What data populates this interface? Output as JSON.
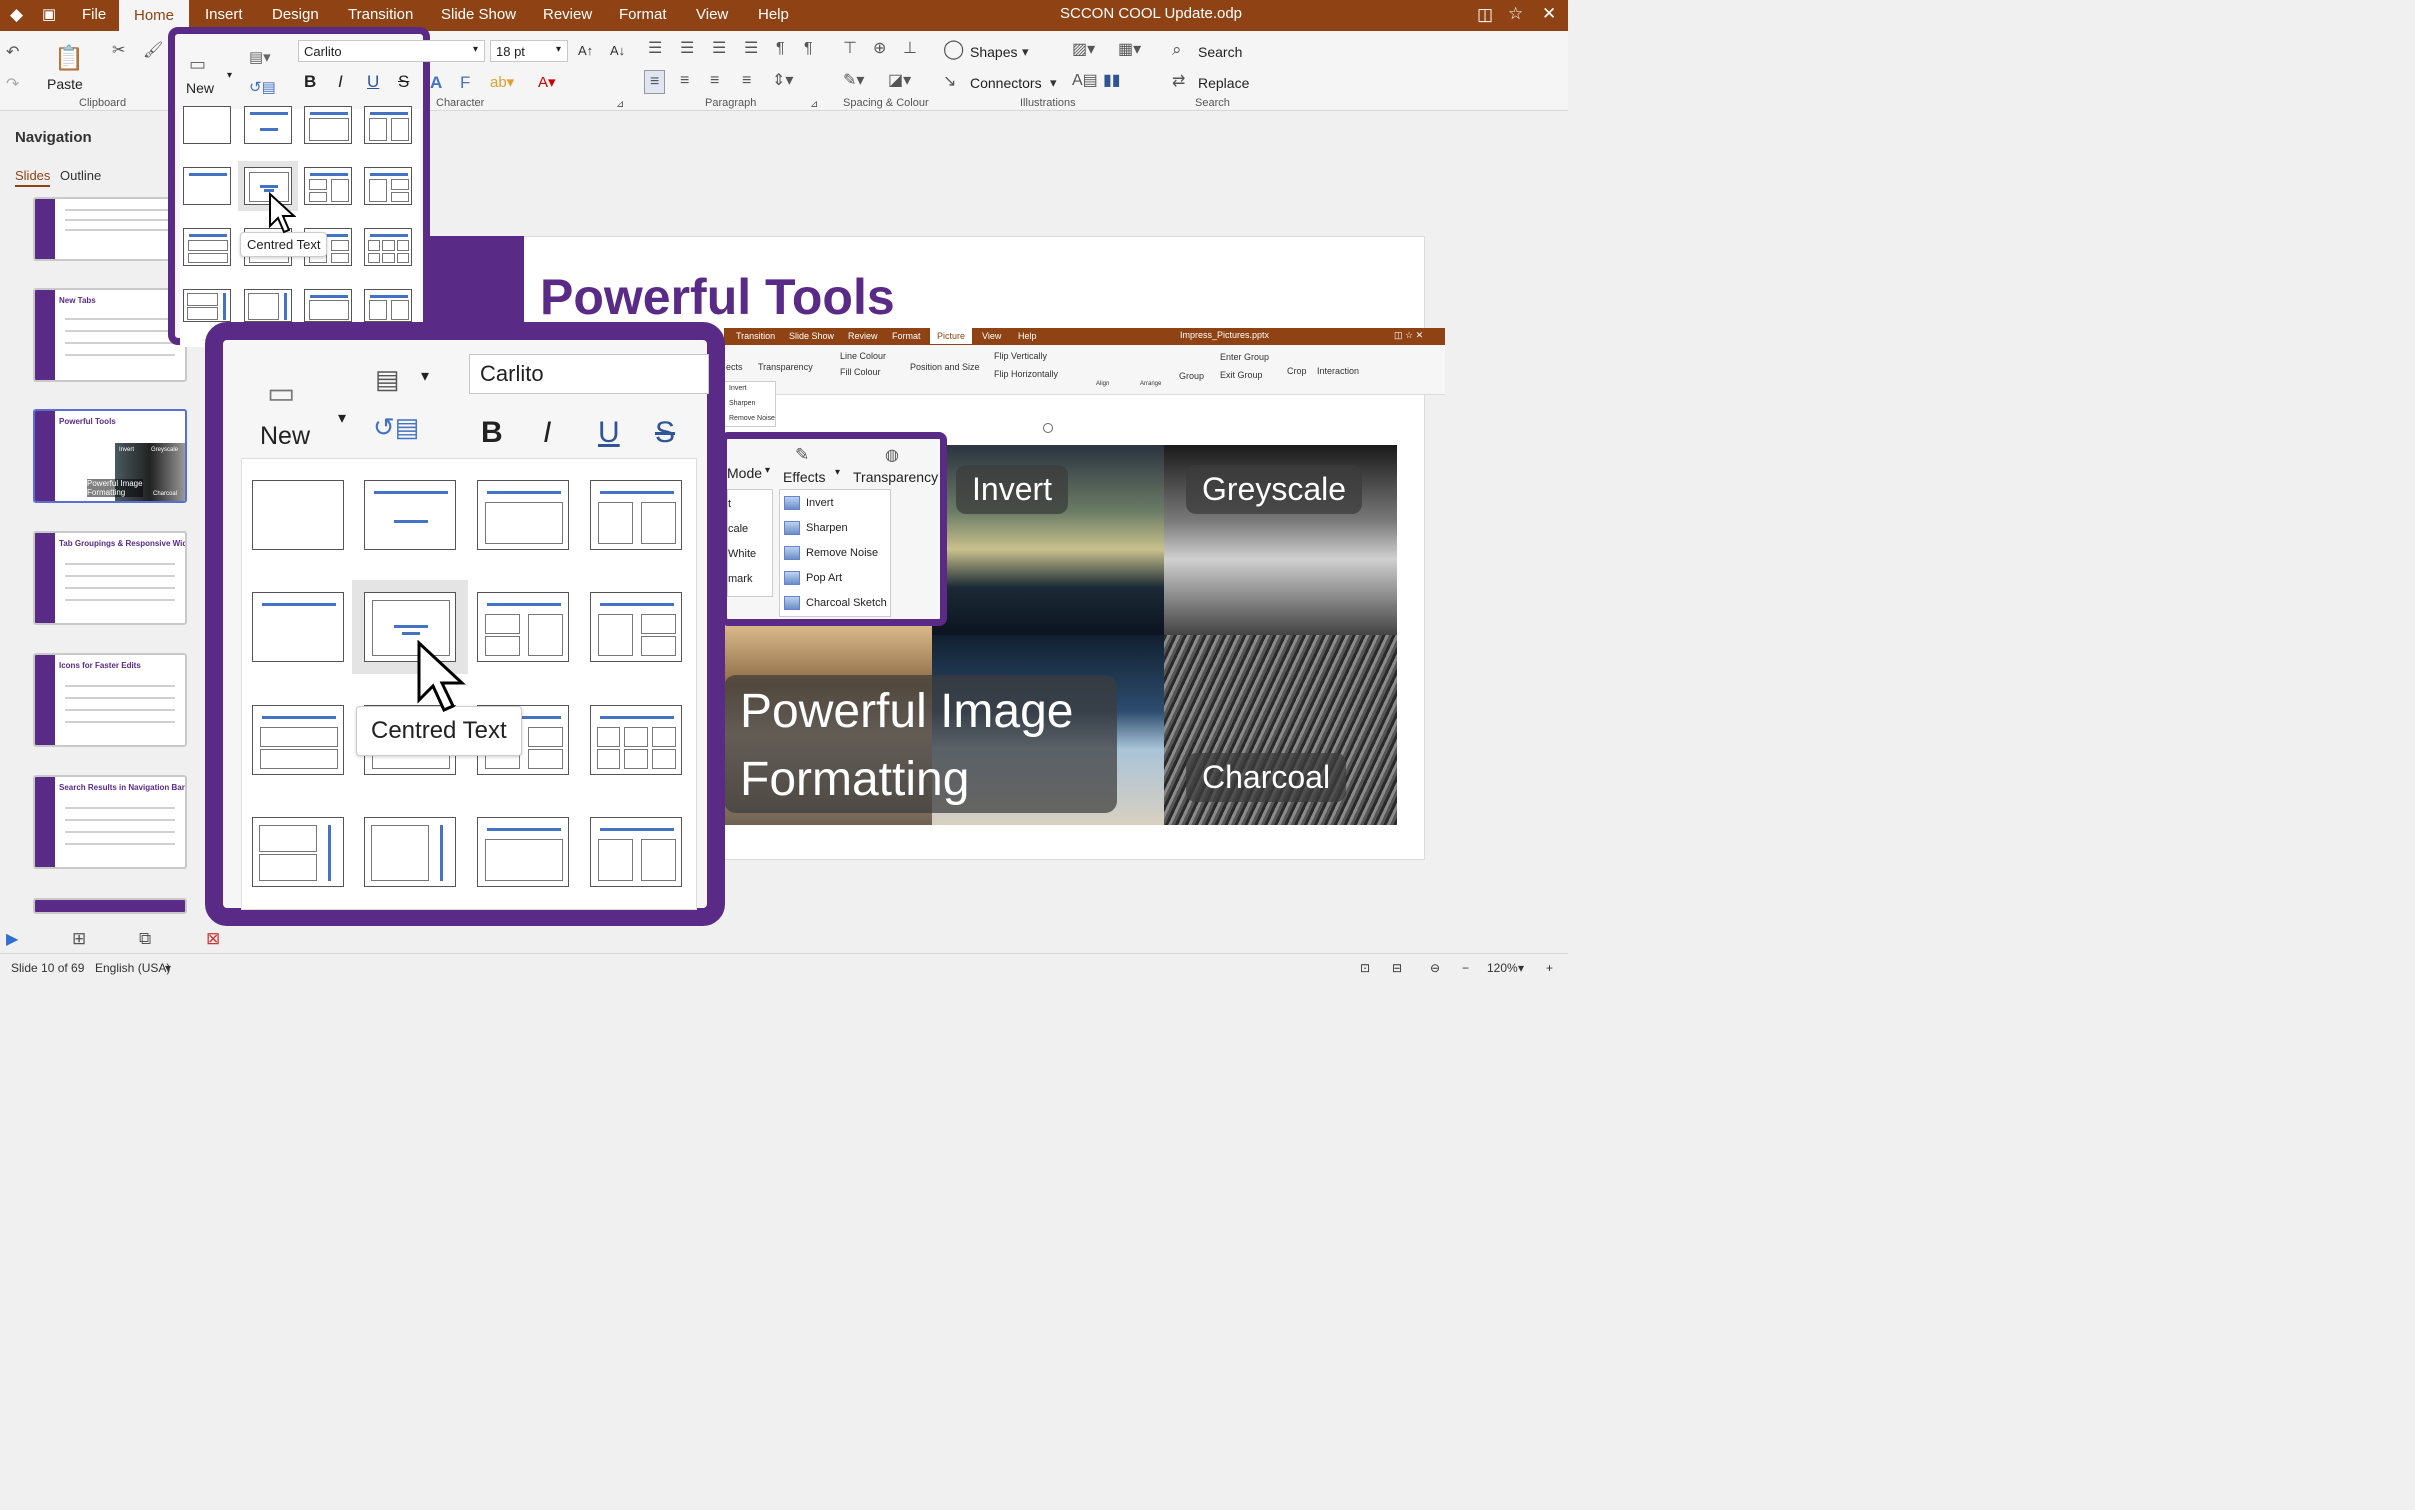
{
  "window": {
    "title": "SCCON COOL Update.odp"
  },
  "menu": [
    "File",
    "Home",
    "Insert",
    "Design",
    "Transition",
    "Slide Show",
    "Review",
    "Format",
    "View",
    "Help"
  ],
  "ribbon": {
    "paste": "Paste",
    "new": "New",
    "font": "Carlito",
    "size": "18 pt",
    "bold": "B",
    "italic": "I",
    "underline": "U",
    "strike": "S",
    "shapes": "Shapes",
    "connectors": "Connectors",
    "search": "Search",
    "replace": "Replace",
    "groups": {
      "clipboard": "Clipboard",
      "character": "Character",
      "paragraph": "Paragraph",
      "spacing": "Spacing & Colour",
      "illustrations": "Illustrations",
      "search": "Search"
    }
  },
  "navigation": {
    "title": "Navigation",
    "tabs": [
      "Slides",
      "Outline"
    ],
    "thumbs": [
      {
        "title": ""
      },
      {
        "title": "New Tabs"
      },
      {
        "title": "Powerful Tools"
      },
      {
        "title": "Tab Groupings & Responsive Width"
      },
      {
        "title": "Icons for Faster Edits"
      },
      {
        "title": "Search Results in Navigation Bar"
      }
    ],
    "thumb_sub": {
      "invert": "Invert",
      "greyscale": "Greyscale",
      "pif": "Powerful Image Formatting",
      "charcoal": "Charcoal"
    }
  },
  "slide": {
    "title": "Powerful Tools",
    "embed": {
      "menu": [
        "Transition",
        "Slide Show",
        "Review",
        "Format",
        "Picture",
        "View",
        "Help"
      ],
      "file": "Impress_Pictures.pptx",
      "ribbon": [
        "ects",
        "Transparency",
        "Line Colour",
        "Fill Colour",
        "Position and Size",
        "Flip Vertically",
        "Flip Horizontally",
        "Align",
        "Arrange",
        "Group",
        "Enter Group",
        "Exit Group",
        "Crop",
        "Interaction"
      ],
      "menu_items": [
        "Invert",
        "Sharpen",
        "Remove Noise"
      ]
    },
    "photos": {
      "invert": "Invert",
      "greyscale": "Greyscale",
      "pif1": "Powerful Image",
      "pif2": "Formatting",
      "charcoal": "Charcoal"
    },
    "effects_popup": {
      "mode": "Mode",
      "effects": "Effects",
      "transparency": "Transparency",
      "left_items": [
        "t",
        "cale",
        "White",
        "mark"
      ],
      "items": [
        "Invert",
        "Sharpen",
        "Remove Noise",
        "Pop Art",
        "Charcoal Sketch"
      ]
    }
  },
  "layout_popup": {
    "tooltip": "Centred Text",
    "new": "New",
    "font": "Carlito"
  },
  "status": {
    "slide": "Slide 10 of 69",
    "language": "English (USA)",
    "zoom": "120%"
  }
}
